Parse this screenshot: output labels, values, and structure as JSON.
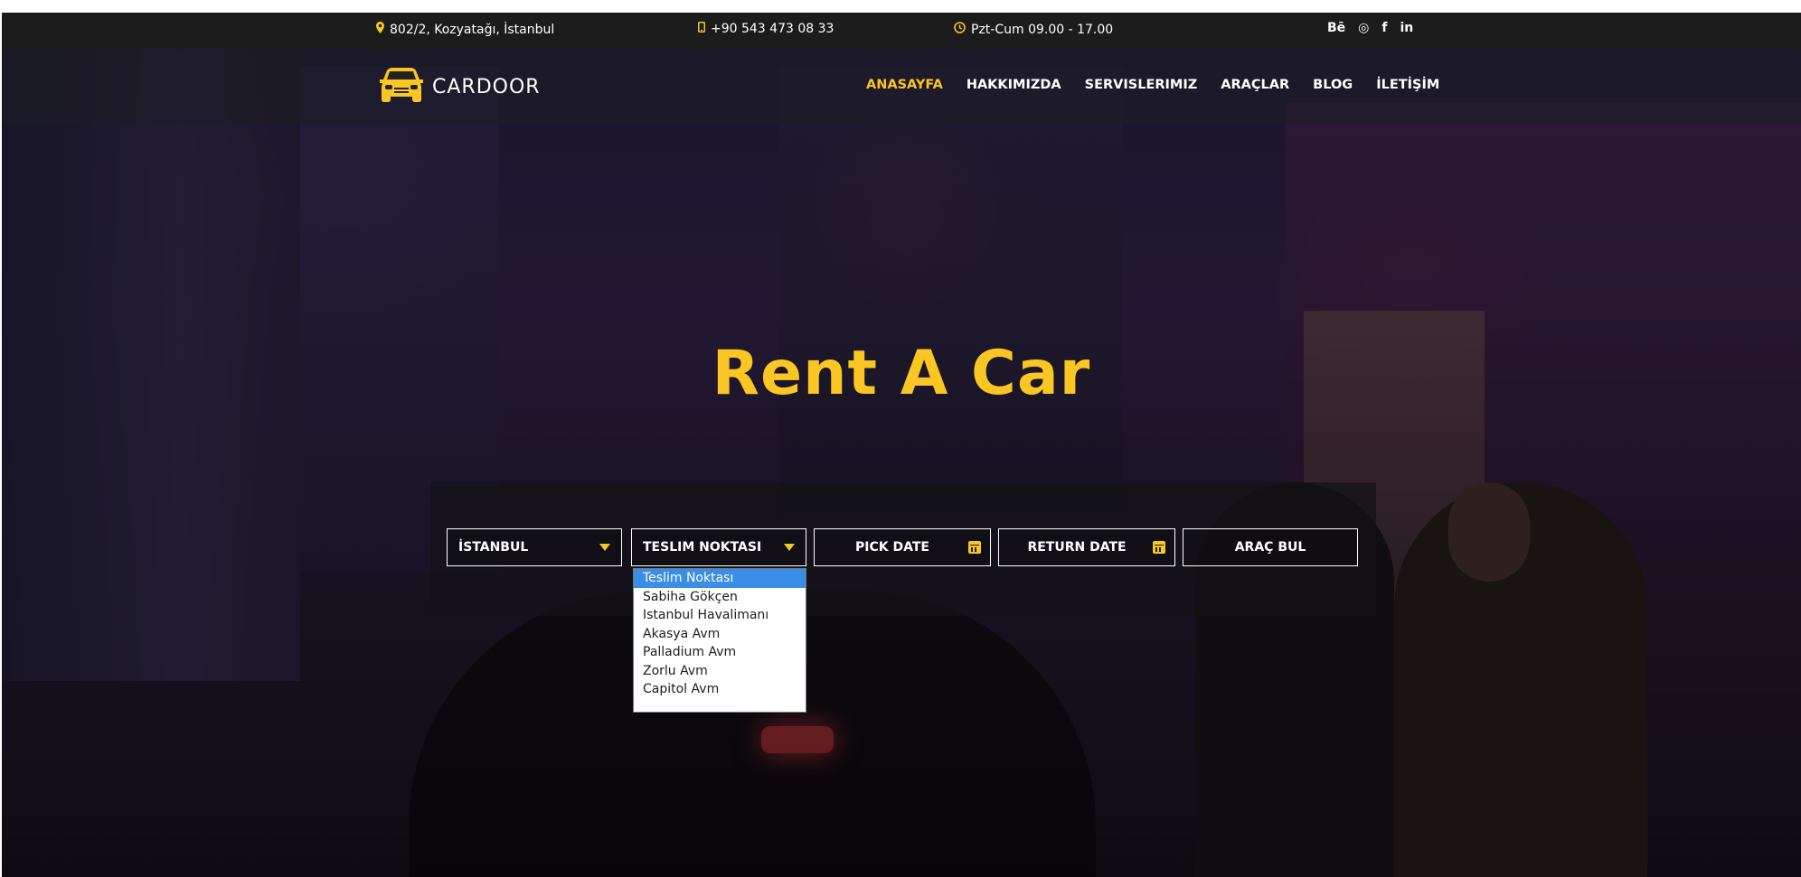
{
  "topbar": {
    "address": "802/2, Kozyatağı, İstanbul",
    "phone": "+90 543 473 08 33",
    "hours": "Pzt-Cum 09.00 - 17.00",
    "social": [
      "Bē",
      "◎",
      "f",
      "in"
    ],
    "icon_color": "#f9c623"
  },
  "brand": {
    "name": "CARDOOR",
    "logo_icon": "car-icon"
  },
  "nav": {
    "items": [
      "ANASAYFA",
      "HAKKIMIZDA",
      "SERVISLERIMIZ",
      "ARAÇLAR",
      "BLOG",
      "İLETİŞİM"
    ],
    "active": "ANASAYFA",
    "accent": "#f9c623"
  },
  "hero": {
    "title": "Rent A Car"
  },
  "booking": {
    "city": "İSTANBUL",
    "delivery_point": "TESLIM NOKTASI",
    "pick_date": "PICK DATE",
    "return_date": "RETURN DATE",
    "search_button": "ARAÇ BUL",
    "delivery_options": [
      "Teslim Noktası",
      "Sabiha Gökçen",
      "Istanbul Havalimanı",
      "Akasya Avm",
      "Palladium Avm",
      "Zorlu Avm",
      "Capitol Avm"
    ],
    "selected_option": "Teslim Noktası"
  }
}
